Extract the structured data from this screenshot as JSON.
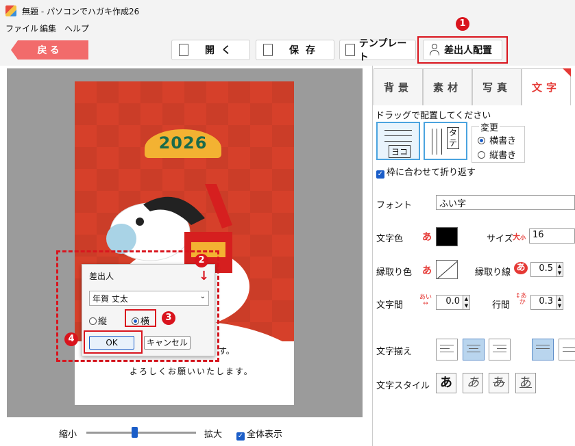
{
  "window": {
    "title": "無題 - パソコンでハガキ作成26"
  },
  "menu": [
    "ファイル",
    "編集",
    "ヘルプ"
  ],
  "toolbar": {
    "back": "戻る",
    "open": "開く",
    "save": "保存",
    "template": "テンプレート",
    "sender": "差出人配置"
  },
  "card": {
    "year": "2026",
    "message": "よろしくお願いいたします。",
    "message_partial": "す。"
  },
  "dialog": {
    "title": "差出人",
    "selected": "年賀 丈太",
    "vertical": "縦",
    "horizontal": "横",
    "ok": "OK",
    "cancel": "キャンセル"
  },
  "badges": [
    "1",
    "2",
    "3",
    "4"
  ],
  "zoom": {
    "shrink": "縮小",
    "enlarge": "拡大",
    "fit": "全体表示",
    "level": 0.44
  },
  "panel": {
    "tabs": [
      "背景",
      "素材",
      "写真",
      "文字"
    ],
    "drag_hint": "ドラッグで配置してください",
    "tile_h": "ヨコ",
    "tile_v": "タテ",
    "change": "変更",
    "horizontal_write": "横書き",
    "vertical_write": "縦書き",
    "wrap": "枠に合わせて折り返す",
    "font_label": "フォント",
    "font_value": "ふい字",
    "color_label": "文字色",
    "size_label": "サイズ",
    "size_value": "16",
    "outline_color_label": "縁取り色",
    "outline_width_label": "縁取り線",
    "outline_width_value": "0.5",
    "char_spacing_label": "文字間",
    "char_spacing_value": "0.0",
    "line_spacing_label": "行間",
    "line_spacing_value": "0.3",
    "align_label": "文字揃え",
    "style_label": "文字スタイル",
    "color_value": "#000000",
    "accent": "#e53935"
  }
}
